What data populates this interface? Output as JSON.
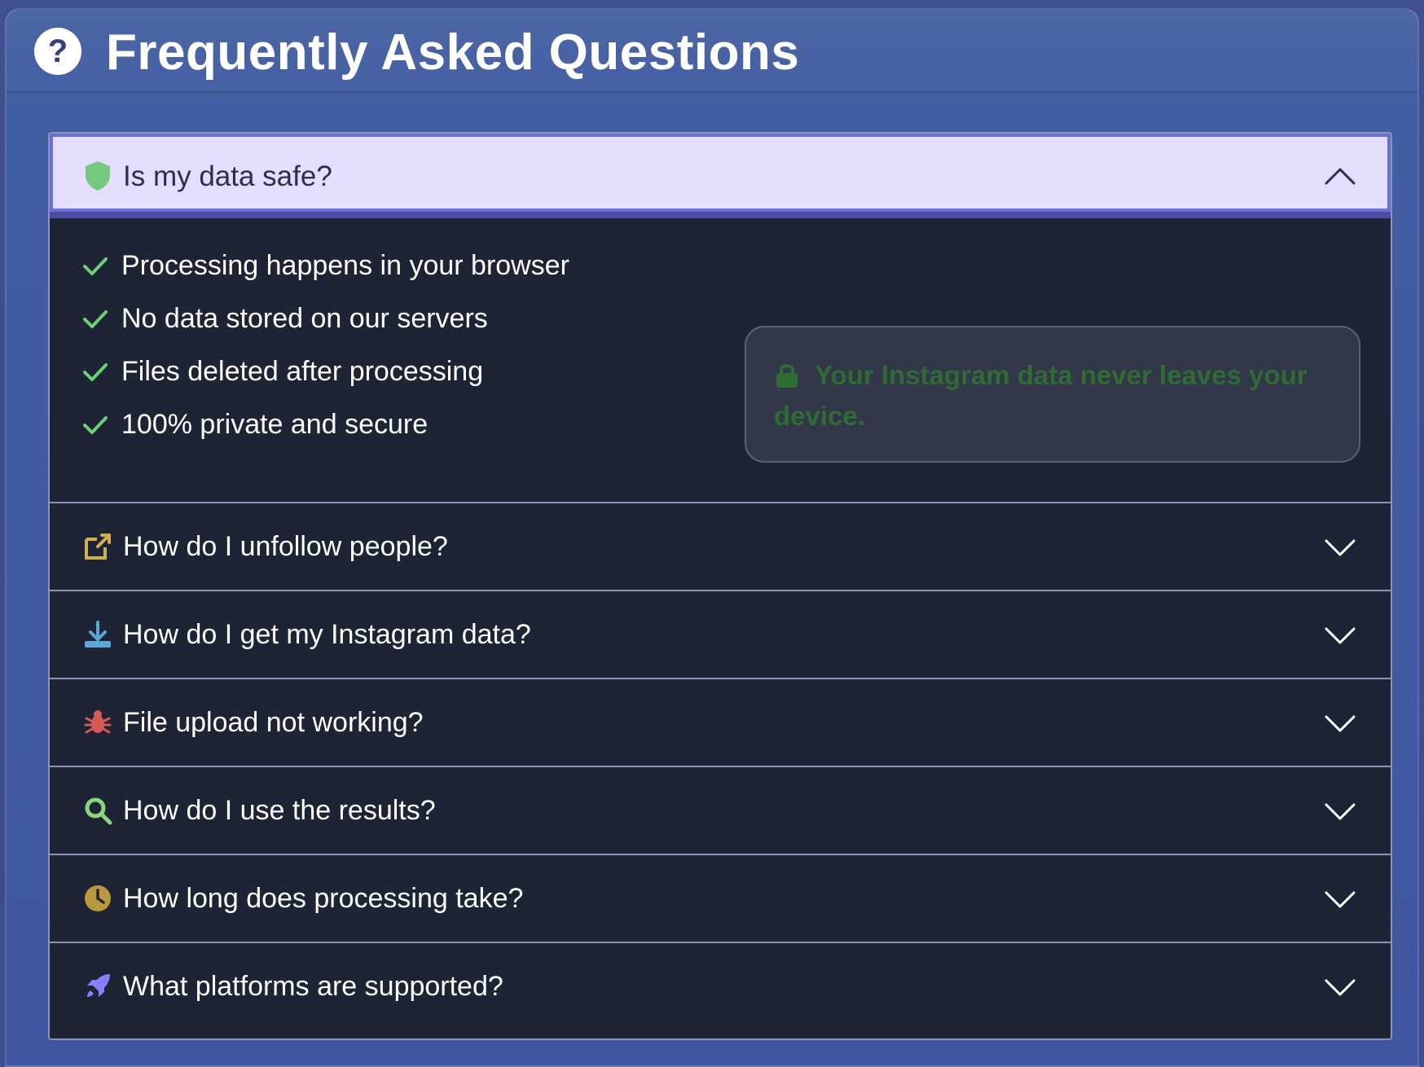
{
  "header": {
    "help_icon_label": "?",
    "title": "Frequently Asked Questions"
  },
  "faq": {
    "open_item": {
      "question": "Is my data safe?",
      "icon": "shield-icon",
      "points": [
        "Processing happens in your browser",
        "No data stored on our servers",
        "Files deleted after processing",
        "100% private and secure"
      ],
      "note": "Your Instagram data never leaves your device."
    },
    "items": [
      {
        "question": "How do I unfollow people?",
        "icon": "external-link-icon",
        "color": "#d1b14d"
      },
      {
        "question": "How do I get my Instagram data?",
        "icon": "download-icon",
        "color": "#5aa6d4"
      },
      {
        "question": "File upload not working?",
        "icon": "bug-icon",
        "color": "#d65a55"
      },
      {
        "question": "How do I use the results?",
        "icon": "search-icon",
        "color": "#8bd67b"
      },
      {
        "question": "How long does processing take?",
        "icon": "clock-icon",
        "color": "#b89a3d"
      },
      {
        "question": "What platforms are supported?",
        "icon": "rocket-icon",
        "color": "#8c7cff"
      }
    ]
  },
  "colors": {
    "accent": "#6a6fd7",
    "check": "#6ad174",
    "note_text": "#2f6b34",
    "panel_bg": "#4056a0",
    "accordion_bg": "#1e2335"
  }
}
